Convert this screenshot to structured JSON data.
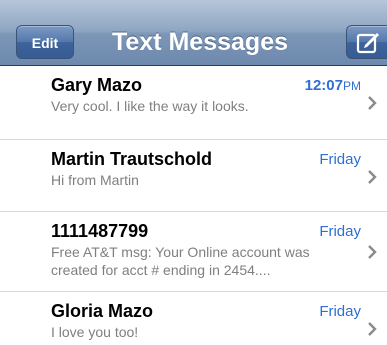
{
  "navbar": {
    "edit_label": "Edit",
    "title": "Text Messages",
    "compose_icon": "compose-icon"
  },
  "messages": [
    {
      "sender": "Gary Mazo",
      "time": "12:07",
      "ampm": "PM",
      "preview": "Very cool. I like the way it looks."
    },
    {
      "sender": "Martin Trautschold",
      "time": "Friday",
      "ampm": "",
      "preview": "Hi from Martin"
    },
    {
      "sender": "1111487799",
      "time": "Friday",
      "ampm": "",
      "preview": "Free AT&T msg: Your Online account was created for acct # ending in 2454...."
    },
    {
      "sender": "Gloria Mazo",
      "time": "Friday",
      "ampm": "",
      "preview": "I love you too!"
    }
  ],
  "colors": {
    "accent_blue": "#2f6fd1",
    "navbar_top": "#b7c6da",
    "navbar_bottom": "#6d89ad",
    "preview_gray": "#7f7f7f"
  }
}
